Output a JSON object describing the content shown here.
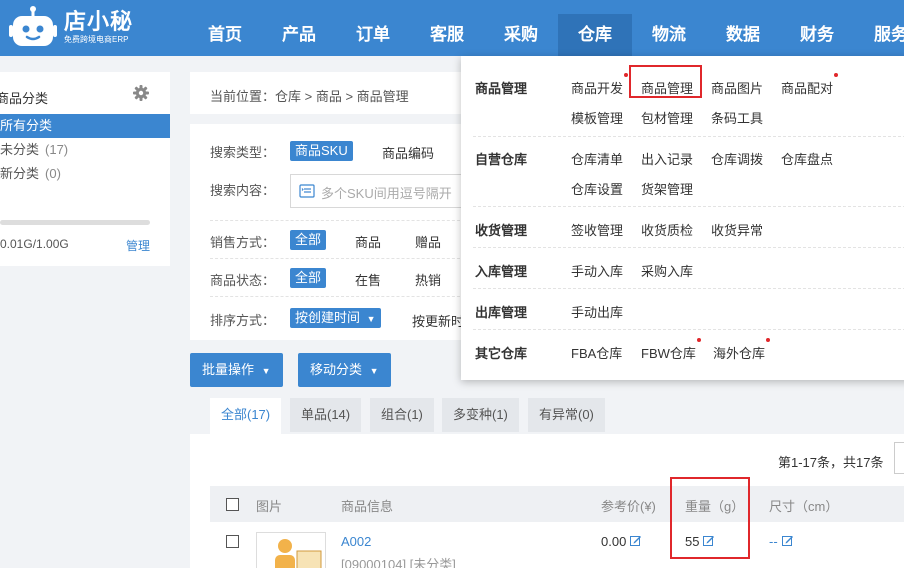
{
  "colors": {
    "brand": "#3b86d0",
    "nav_active": "#2f73b8",
    "highlight_box": "#e0272b",
    "notify_dot": "#e0272b"
  },
  "logo": {
    "name": "店小秘",
    "tagline": "免费跨境电商ERP"
  },
  "nav": [
    "首页",
    "产品",
    "订单",
    "客服",
    "采购",
    "仓库",
    "物流",
    "数据",
    "财务",
    "服务"
  ],
  "nav_active": "仓库",
  "sidebar": {
    "title": "商品分类",
    "items": [
      {
        "label": "所有分类",
        "count": ""
      },
      {
        "label": "未分类",
        "count": "(17)"
      },
      {
        "label": "新分类",
        "count": "(0)"
      }
    ],
    "storage": "0.01G/1.00G",
    "manage": "管理"
  },
  "breadcrumb": {
    "label": "当前位置：",
    "path": "仓库 > 商品 > 商品管理"
  },
  "search": {
    "type_label": "搜索类型：",
    "type_selected": "商品SKU",
    "type_other": "商品编码",
    "content_label": "搜索内容：",
    "content_placeholder": "多个SKU间用逗号隔开",
    "sale_label": "销售方式：",
    "sale_options": [
      "全部",
      "商品",
      "赠品"
    ],
    "status_label": "商品状态：",
    "status_options": [
      "全部",
      "在售",
      "热销"
    ],
    "sort_label": "排序方式：",
    "sort_selected": "按创建时间",
    "sort_other": "按更新时"
  },
  "actions": {
    "bulk": "批量操作",
    "move": "移动分类"
  },
  "tabs": [
    "全部(17)",
    "单品(14)",
    "组合(1)",
    "多变种(1)",
    "有异常(0)"
  ],
  "pager": "第1-17条，共17条",
  "table": {
    "headers": [
      "图片",
      "商品信息",
      "参考价(¥)",
      "重量（g）",
      "尺寸（cm）"
    ],
    "rows": [
      {
        "sku": "A002",
        "meta": "[09000104] [未分类]",
        "price": "0.00",
        "weight": "55",
        "size": "--"
      }
    ]
  },
  "dropdown": {
    "groups": [
      {
        "name": "商品管理",
        "links": [
          "商品开发",
          "商品管理",
          "商品图片",
          "商品配对",
          "模板管理",
          "包材管理",
          "条码工具"
        ]
      },
      {
        "name": "自营仓库",
        "links": [
          "仓库清单",
          "出入记录",
          "仓库调拨",
          "仓库盘点",
          "仓库设置",
          "货架管理"
        ]
      },
      {
        "name": "收货管理",
        "links": [
          "签收管理",
          "收货质检",
          "收货异常"
        ]
      },
      {
        "name": "入库管理",
        "links": [
          "手动入库",
          "采购入库"
        ]
      },
      {
        "name": "出库管理",
        "links": [
          "手动出库"
        ]
      },
      {
        "name": "其它仓库",
        "links": [
          "FBA仓库",
          "FBW仓库",
          "海外仓库"
        ]
      }
    ]
  }
}
